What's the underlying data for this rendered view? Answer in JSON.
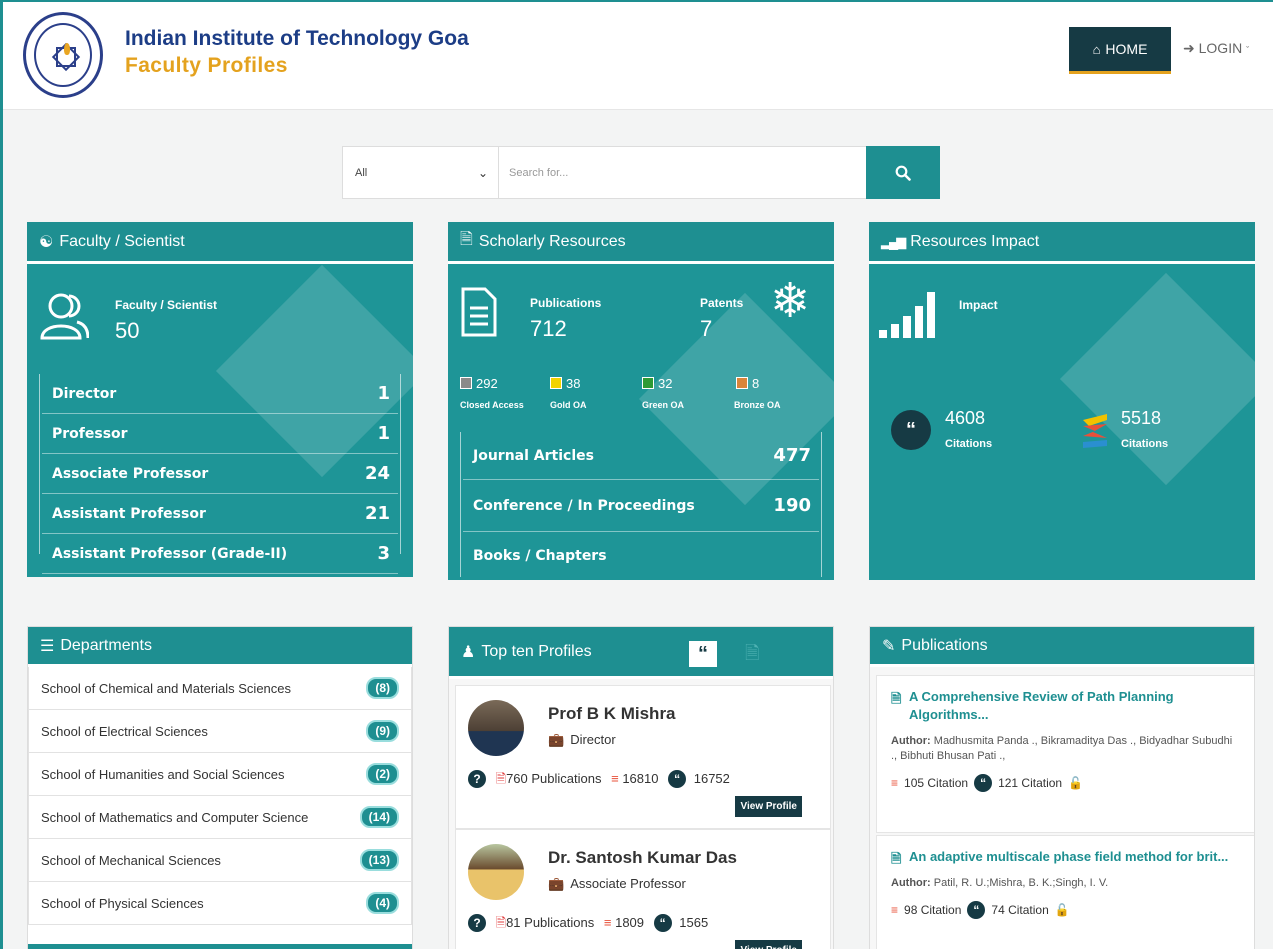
{
  "header": {
    "title": "Indian Institute of Technology Goa",
    "subtitle": "Faculty Profiles",
    "home": "HOME",
    "login": "LOGIN"
  },
  "search": {
    "select": "All",
    "placeholder": "Search for..."
  },
  "faculty": {
    "heading": "Faculty / Scientist",
    "label": "Faculty / Scientist",
    "count": "50",
    "items": [
      {
        "label": "Director",
        "count": "1"
      },
      {
        "label": "Professor",
        "count": "1"
      },
      {
        "label": "Associate Professor",
        "count": "24"
      },
      {
        "label": "Assistant Professor",
        "count": "21"
      },
      {
        "label": "Assistant Professor (Grade-II)",
        "count": "3"
      }
    ]
  },
  "scholarly": {
    "heading": "Scholarly Resources",
    "pub_label": "Publications",
    "pub_count": "712",
    "pat_label": "Patents",
    "pat_count": "7",
    "oa": [
      {
        "value": "292",
        "label": "Closed Access",
        "color": "#8a8a8a"
      },
      {
        "value": "38",
        "label": "Gold OA",
        "color": "#f2d300"
      },
      {
        "value": "32",
        "label": "Green OA",
        "color": "#2e9a35"
      },
      {
        "value": "8",
        "label": "Bronze OA",
        "color": "#d9853a"
      }
    ],
    "items": [
      {
        "label": "Journal Articles",
        "count": "477"
      },
      {
        "label": "Conference / In Proceedings",
        "count": "190"
      },
      {
        "label": "Books / Chapters",
        "count": ""
      }
    ]
  },
  "impact": {
    "heading": "Resources Impact",
    "label": "Impact",
    "cit1": "4608",
    "cit1_label": "Citations",
    "cit2": "5518",
    "cit2_label": "Citations"
  },
  "departments": {
    "heading": "Departments",
    "items": [
      {
        "label": "School of Chemical and Materials Sciences",
        "count": "(8)"
      },
      {
        "label": "School of Electrical Sciences",
        "count": "(9)"
      },
      {
        "label": "School of Humanities and Social Sciences",
        "count": "(2)"
      },
      {
        "label": "School of Mathematics and Computer Science",
        "count": "(14)"
      },
      {
        "label": "School of Mechanical Sciences",
        "count": "(13)"
      },
      {
        "label": "School of Physical Sciences",
        "count": "(4)"
      }
    ]
  },
  "topten": {
    "heading": "Top ten Profiles",
    "profiles": [
      {
        "name": "Prof B K Mishra",
        "role": "Director",
        "pubs": "760 Publications",
        "c1": "16810",
        "c2": "16752",
        "btn": "View Profile"
      },
      {
        "name": "Dr. Santosh Kumar Das",
        "role": "Associate Professor",
        "pubs": "81 Publications",
        "c1": "1809",
        "c2": "1565",
        "btn": "View Profile"
      }
    ]
  },
  "publications": {
    "heading": "Publications",
    "items": [
      {
        "title": "A Comprehensive Review of Path Planning Algorithms...",
        "author_label": "Author:",
        "authors": "Madhusmita Panda ., Bikramaditya Das ., Bidyadhar Subudhi ., Bibhuti Bhusan Pati .,",
        "c1": "105 Citation",
        "c2": "121 Citation"
      },
      {
        "title": "An adaptive multiscale phase field method for brit...",
        "author_label": "Author:",
        "authors": "Patil, R. U.;Mishra, B. K.;Singh, I. V.",
        "c1": "98 Citation",
        "c2": "74 Citation"
      }
    ]
  }
}
